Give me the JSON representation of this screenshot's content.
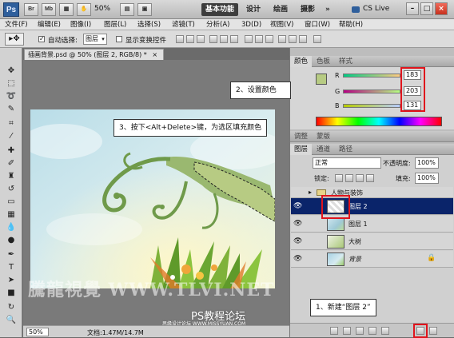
{
  "titlebar": {
    "logo": "Ps",
    "icons": [
      "Br",
      "Mb"
    ],
    "zoom": "50%",
    "workspaces": [
      "基本功能",
      "设计",
      "绘画",
      "摄影"
    ],
    "more": "»",
    "cslive": "CS Live",
    "controls": [
      "–",
      "□",
      "×"
    ]
  },
  "menu": [
    "文件(F)",
    "编辑(E)",
    "图像(I)",
    "图层(L)",
    "选择(S)",
    "滤镜(T)",
    "分析(A)",
    "3D(D)",
    "视图(V)",
    "窗口(W)",
    "帮助(H)"
  ],
  "options": {
    "auto_select_label": "自动选择:",
    "auto_select_value": "图层",
    "show_transform": "显示变换控件"
  },
  "document": {
    "tab_title": "插画背景.psd @ 50% (图层 2, RGB/8) *",
    "zoom": "50%",
    "doc_size": "文档:1.47M/14.7M"
  },
  "color_panel": {
    "tabs": [
      "颜色",
      "色板",
      "样式"
    ],
    "channels": [
      {
        "label": "R",
        "value": "183"
      },
      {
        "label": "G",
        "value": "203"
      },
      {
        "label": "B",
        "value": "131"
      }
    ],
    "swatch": "#b7cb83"
  },
  "adjust_panel": {
    "tabs": [
      "调整",
      "蒙版"
    ]
  },
  "layers_panel": {
    "tabs": [
      "图层",
      "通道",
      "路径"
    ],
    "blend_mode": "正常",
    "opacity_label": "不透明度:",
    "opacity": "100%",
    "lock_label": "锁定:",
    "fill_label": "填充:",
    "fill": "100%",
    "layers": [
      {
        "name": "人物与装饰",
        "type": "group"
      },
      {
        "name": "图层 2",
        "type": "layer",
        "selected": true
      },
      {
        "name": "图层 1",
        "type": "layer"
      },
      {
        "name": "大树",
        "type": "layer"
      },
      {
        "name": "背景",
        "type": "background"
      }
    ]
  },
  "callouts": {
    "step1": "1、新建“图层 2”",
    "step2": "2、设置颜色",
    "step3": "3、按下<Alt+Delete>键，为选区填充颜色"
  },
  "watermarks": {
    "site": "騰龍視覺 WWW.TLVI.NET",
    "forum": "PS教程论坛",
    "forum2": "思缘设计论坛 WWW.MISSYUAN.COM"
  },
  "colors": {
    "accent_red": "#e0141c",
    "selected_layer": "#0a246a"
  }
}
